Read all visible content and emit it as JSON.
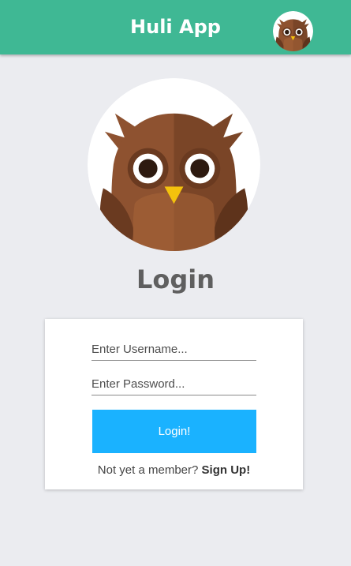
{
  "header": {
    "title": "Huli App",
    "avatar_icon": "owl-avatar-icon"
  },
  "hero": {
    "avatar_icon": "owl-logo-icon"
  },
  "login": {
    "heading": "Login",
    "username_placeholder": "Enter Username...",
    "password_placeholder": "Enter Password...",
    "submit_label": "Login!",
    "signup_prompt": "Not yet a member?",
    "signup_link": "Sign Up!"
  },
  "colors": {
    "header_bg": "#3fb894",
    "page_bg": "#ebecf0",
    "button_bg": "#1ab2ff",
    "owl_brown": "#8e5230"
  }
}
